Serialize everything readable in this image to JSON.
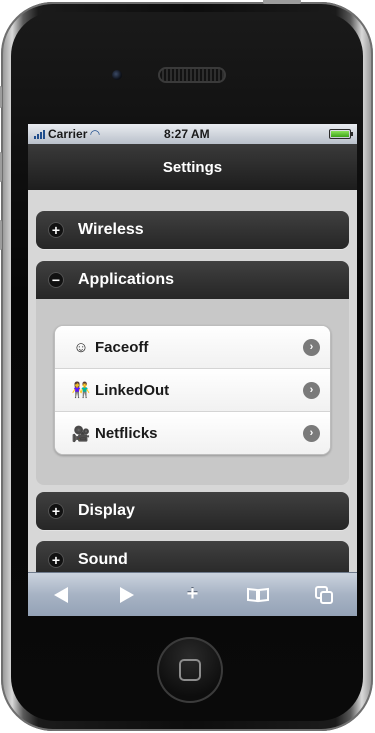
{
  "status": {
    "carrier": "Carrier",
    "time": "8:27 AM"
  },
  "title": "Settings",
  "sections": [
    {
      "label": "Wireless",
      "state": "collapsed",
      "sign": "+"
    },
    {
      "label": "Applications",
      "state": "expanded",
      "sign": "−"
    },
    {
      "label": "Display",
      "state": "collapsed",
      "sign": "+"
    },
    {
      "label": "Sound",
      "state": "collapsed",
      "sign": "+"
    }
  ],
  "apps": [
    {
      "label": "Faceoff",
      "icon": "face-icon",
      "glyph": "☺"
    },
    {
      "label": "LinkedOut",
      "icon": "people-icon",
      "glyph": "👫"
    },
    {
      "label": "Netflicks",
      "icon": "camera-icon",
      "glyph": "🎥"
    }
  ],
  "toolbar": {
    "back": "back-arrow-icon",
    "forward": "forward-arrow-icon",
    "add": "plus-icon",
    "bookmarks": "book-icon",
    "pages": "pages-icon"
  },
  "colors": {
    "header": "#2f2f2f",
    "toolbar": "#a7b3c4",
    "battery": "#4cbf22"
  }
}
